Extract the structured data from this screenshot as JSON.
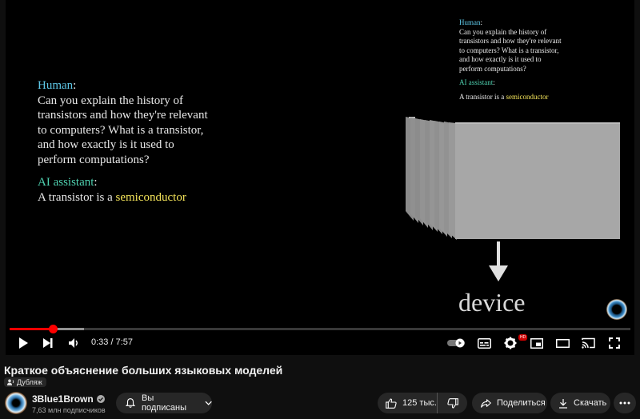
{
  "video": {
    "dialog": {
      "human_label": "Human",
      "human_question_lines": [
        "Can you explain the history of",
        "transistors and how they're relevant",
        "to computers? What is a transistor,",
        "and how exactly is it used to",
        "perform computations?"
      ],
      "ai_label": "AI assistant",
      "ai_answer_prefix": "A transistor is a ",
      "ai_answer_highlight": "semiconductor"
    },
    "device_label": "device"
  },
  "player": {
    "time_display": "0:33 / 7:57",
    "progress_played_fraction": 0.069,
    "progress_loaded_fraction": 0.12,
    "quality_badge": "HD"
  },
  "video_title": "Краткое объяснение больших языковых моделей",
  "dub_badge": "Дубляж",
  "channel": {
    "name": "3Blue1Brown",
    "subscribers": "7,63 млн подписчиков"
  },
  "actions": {
    "subscribed_label": "Вы подписаны",
    "likes": "125 тыс.",
    "share_label": "Поделиться",
    "download_label": "Скачать"
  },
  "colors": {
    "progress": "#ff0000",
    "human_label": "#5ec8e8",
    "ai_label": "#4fd1b0",
    "highlight": "#f4e45a"
  }
}
